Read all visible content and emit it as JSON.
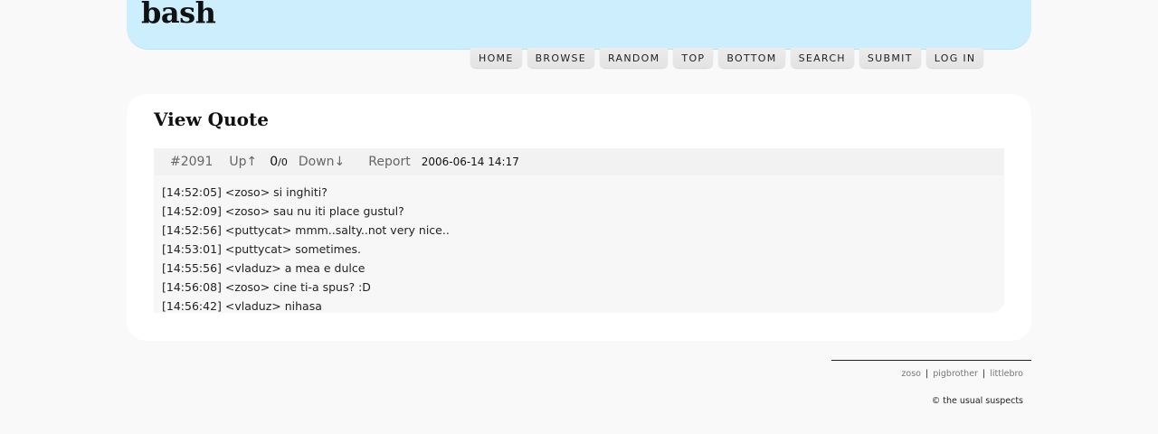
{
  "site": {
    "title": "bash"
  },
  "nav": {
    "home": "HOME",
    "browse": "BROWSE",
    "random": "RANDOM",
    "top": "TOP",
    "bottom": "BOTTOM",
    "search": "SEARCH",
    "submit": "SUBMIT",
    "login": "LOG IN"
  },
  "main": {
    "heading": "View Quote",
    "quote": {
      "id": "#2091",
      "up": "Up↑",
      "score": "0",
      "slash": "/",
      "votes": "0",
      "down": "Down↓",
      "report": "Report",
      "date": "2006-06-14 14:17",
      "lines": [
        "[14:52:05] <zoso> si inghiti?",
        "[14:52:09] <zoso> sau nu iti place gustul?",
        "[14:52:56] <puttycat> mmm..salty..not very nice..",
        "[14:53:01] <puttycat> sometimes.",
        "[14:55:56] <vladuz> a mea e dulce",
        "[14:56:08] <zoso> cine ti-a spus? :D",
        "[14:56:42] <vladuz> nihasa"
      ]
    }
  },
  "footer": {
    "links": [
      "zoso",
      "pigbrother",
      "littlebro"
    ],
    "separator": "|",
    "copyright": "© the usual suspects"
  }
}
